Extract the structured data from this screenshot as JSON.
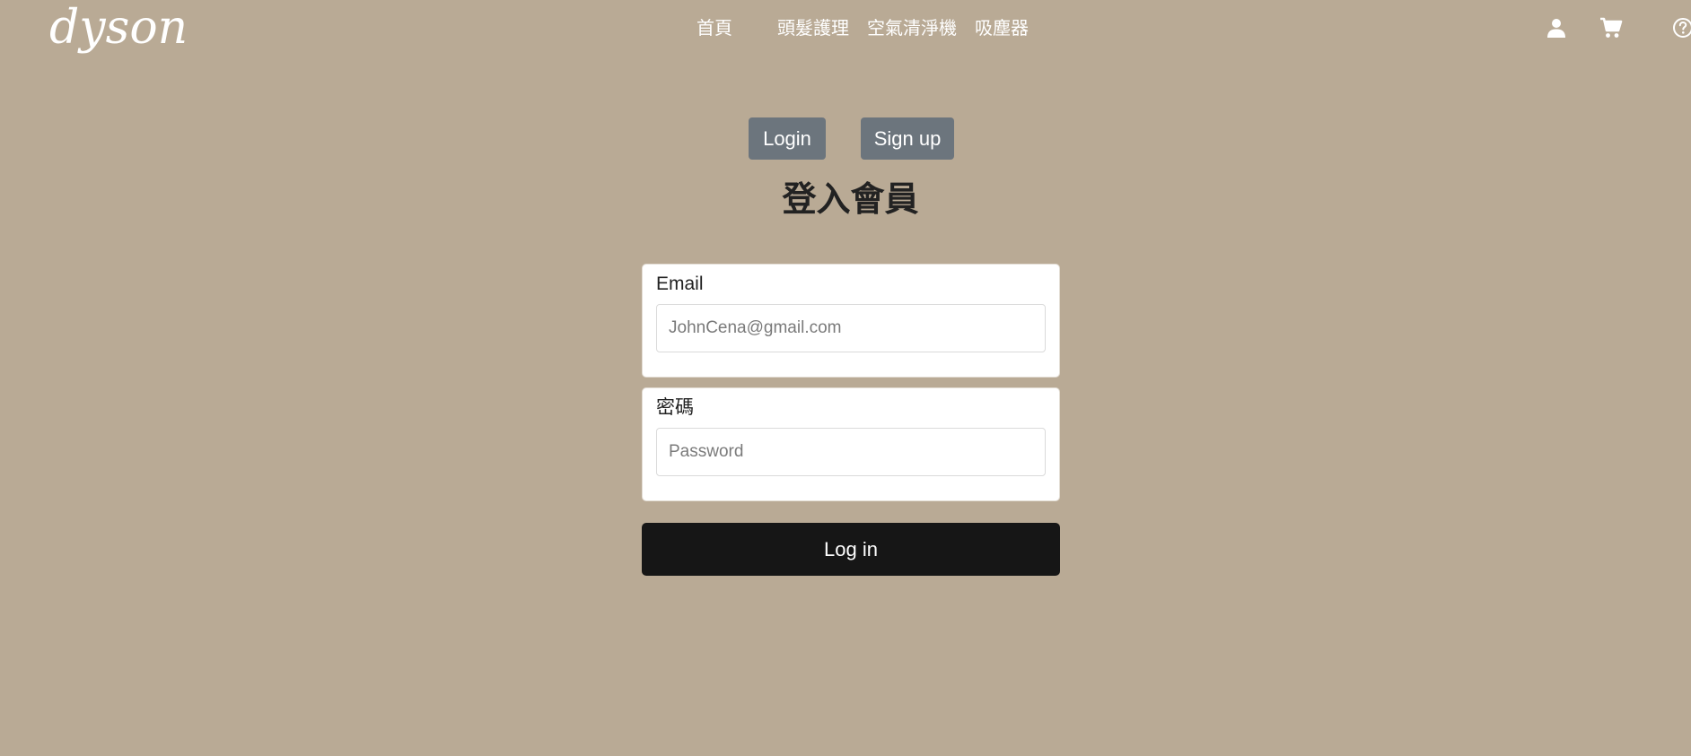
{
  "brand": {
    "logo_text": "dyson"
  },
  "nav": {
    "links": [
      {
        "label": "首頁"
      },
      {
        "label": "頭髮護理"
      },
      {
        "label": "空氣清淨機"
      },
      {
        "label": "吸塵器"
      }
    ],
    "icons": [
      "user-icon",
      "cart-icon",
      "help-icon"
    ]
  },
  "auth_tabs": {
    "login_label": "Login",
    "signup_label": "Sign up"
  },
  "page": {
    "title": "登入會員"
  },
  "form": {
    "email": {
      "label": "Email",
      "placeholder": "JohnCena@gmail.com"
    },
    "password": {
      "label": "密碼",
      "placeholder": "Password"
    },
    "submit_label": "Log in"
  },
  "colors": {
    "background": "#b9aa95",
    "tab_button": "#6c757d",
    "submit_button": "#161616",
    "card": "#ffffff"
  }
}
